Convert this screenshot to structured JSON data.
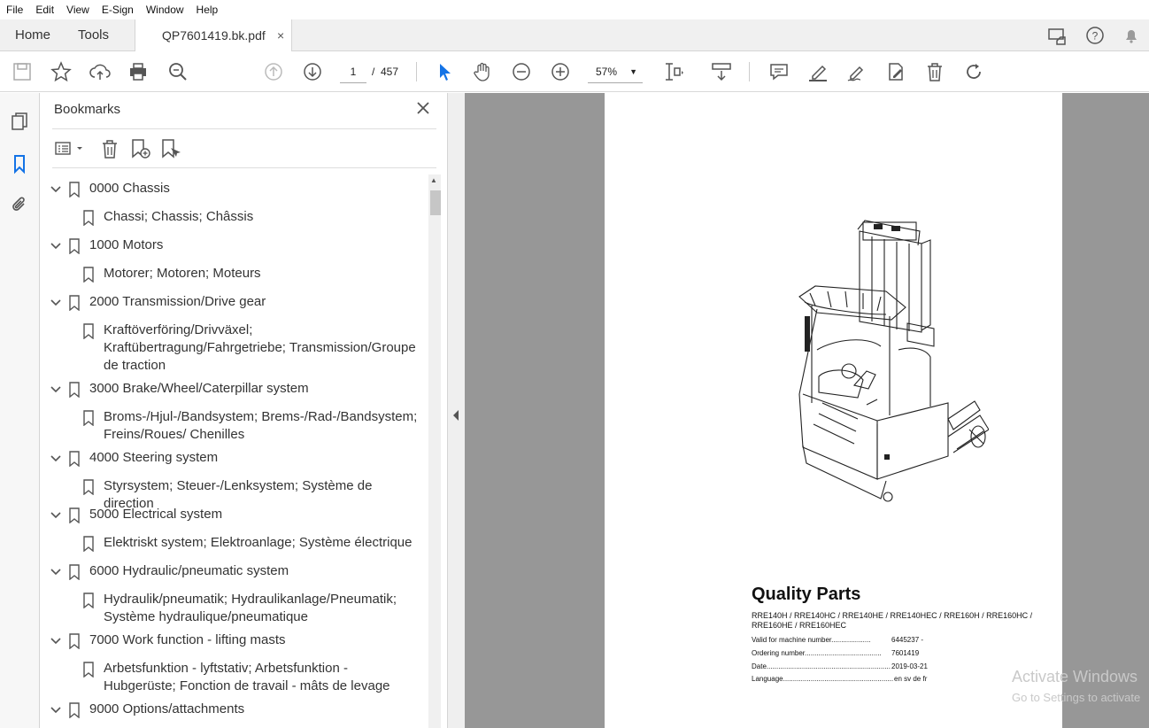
{
  "menu": {
    "items": [
      "File",
      "Edit",
      "View",
      "E-Sign",
      "Window",
      "Help"
    ]
  },
  "tabs": {
    "home": "Home",
    "tools": "Tools",
    "document": "QP7601419.bk.pdf",
    "close": "×"
  },
  "toolbar": {
    "current_page": "1",
    "page_separator": "/",
    "total_pages": "457",
    "zoom": "57%"
  },
  "bookmarks_panel": {
    "title": "Bookmarks",
    "items": [
      {
        "label": "0000 Chassis",
        "level": 1
      },
      {
        "label": "Chassi; Chassis; Châssis",
        "level": 2
      },
      {
        "label": "1000 Motors",
        "level": 1
      },
      {
        "label": "Motorer; Motoren; Moteurs",
        "level": 2
      },
      {
        "label": "2000 Transmission/Drive gear",
        "level": 1
      },
      {
        "label": "Kraftöverföring/Drivväxel; Kraftübertragung/Fahrgetriebe; Transmission/Groupe de traction",
        "level": 2
      },
      {
        "label": "3000 Brake/Wheel/Caterpillar system",
        "level": 1
      },
      {
        "label": "Broms-/Hjul-/Bandsystem; Brems-/Rad-/Bandsystem; Freins/Roues/ Chenilles",
        "level": 2
      },
      {
        "label": "4000 Steering system",
        "level": 1
      },
      {
        "label": "Styrsystem; Steuer-/Lenksystem; Système de direction",
        "level": 2
      },
      {
        "label": "5000 Electrical system",
        "level": 1
      },
      {
        "label": "Elektriskt system; Elektroanlage; Système électrique",
        "level": 2
      },
      {
        "label": "6000 Hydraulic/pneumatic system",
        "level": 1
      },
      {
        "label": "Hydraulik/pneumatik; Hydraulikanlage/Pneumatik; Système hydraulique/pneumatique",
        "level": 2
      },
      {
        "label": "7000 Work function - lifting masts",
        "level": 1
      },
      {
        "label": "Arbetsfunktion - lyftstativ; Arbetsfunktion - Hubgerüste; Fonction de travail - mâts de levage",
        "level": 2
      },
      {
        "label": "9000 Options/attachments",
        "level": 1
      }
    ]
  },
  "document_page": {
    "title": "Quality Parts",
    "models": "RRE140H / RRE140HC / RRE140HE / RRE140HEC / RRE160H / RRE160HC / RRE160HE / RRE160HEC",
    "fields": [
      {
        "label": "Valid for machine number....................",
        "value": "6445237 -"
      },
      {
        "label": "Ordering number.......................................",
        "value": "7601419"
      },
      {
        "label": "Date...............................................................",
        "value": "2019-03-21"
      },
      {
        "label": "Language........................................................",
        "value": "en sv de fr"
      }
    ]
  },
  "watermark": {
    "line1": "Activate Windows",
    "line2": "Go to Settings to activate"
  },
  "colors": {
    "accent": "#1473e6",
    "viewer_bg": "#979797"
  }
}
